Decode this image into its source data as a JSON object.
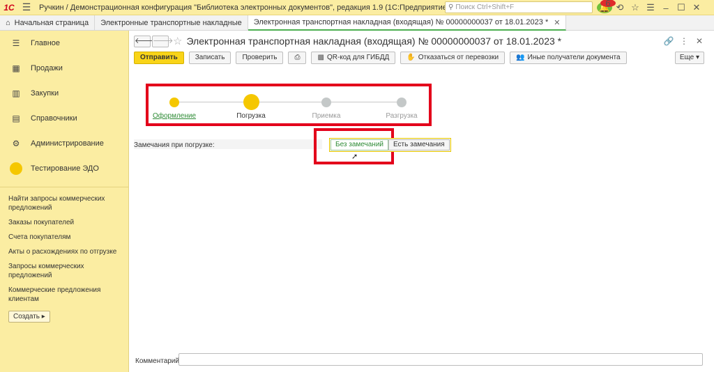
{
  "titlebar": {
    "logo": "1С",
    "title": "Ручкин / Демонстрационная конфигурация \"Библиотека электронных документов\", редакция 1.9  (1С:Предприятие)",
    "search_placeholder": "Поиск Ctrl+Shift+F",
    "notifications_count": "6"
  },
  "tabs": [
    {
      "label": "Начальная страница"
    },
    {
      "label": "Электронные транспортные накладные"
    },
    {
      "label": "Электронная транспортная накладная (входящая) № 00000000037 от 18.01.2023 *"
    }
  ],
  "sidebar": {
    "sections": [
      {
        "label": "Главное"
      },
      {
        "label": "Продажи"
      },
      {
        "label": "Закупки"
      },
      {
        "label": "Справочники"
      },
      {
        "label": "Администрирование"
      },
      {
        "label": "Тестирование ЭДО"
      }
    ],
    "links": [
      {
        "label": "Найти запросы коммерческих предложений"
      },
      {
        "label": "Заказы покупателей"
      },
      {
        "label": "Счета покупателям"
      },
      {
        "label": "Акты о расхождениях по отгрузке"
      },
      {
        "label": "Запросы коммерческих предложений"
      },
      {
        "label": "Коммерческие предложения клиентам"
      }
    ],
    "create_label": "Создать"
  },
  "form": {
    "title": "Электронная транспортная накладная (входящая) № 00000000037 от 18.01.2023 *",
    "buttons": {
      "send": "Отправить",
      "save": "Записать",
      "check": "Проверить",
      "qr": "QR-код для ГИБДД",
      "refuse": "Отказаться от перевозки",
      "recipients": "Иные получатели документа",
      "more": "Еще"
    },
    "steps": [
      {
        "label": "Оформление",
        "state": "done"
      },
      {
        "label": "Погрузка",
        "state": "current"
      },
      {
        "label": "Приемка",
        "state": "pending"
      },
      {
        "label": "Разгрузка",
        "state": "pending"
      }
    ],
    "remarks_label": "Замечания при погрузке:",
    "remarks_options": [
      "Без замечаний",
      "Есть замечания"
    ],
    "remarks_selected": "Без замечаний",
    "comment_label": "Комментарий:",
    "comment_value": ""
  },
  "colors": {
    "accent_yellow": "#f9d418",
    "sidebar_bg": "#fbeda2",
    "highlight_red": "#e3001b",
    "done_green": "#2e8b35"
  }
}
